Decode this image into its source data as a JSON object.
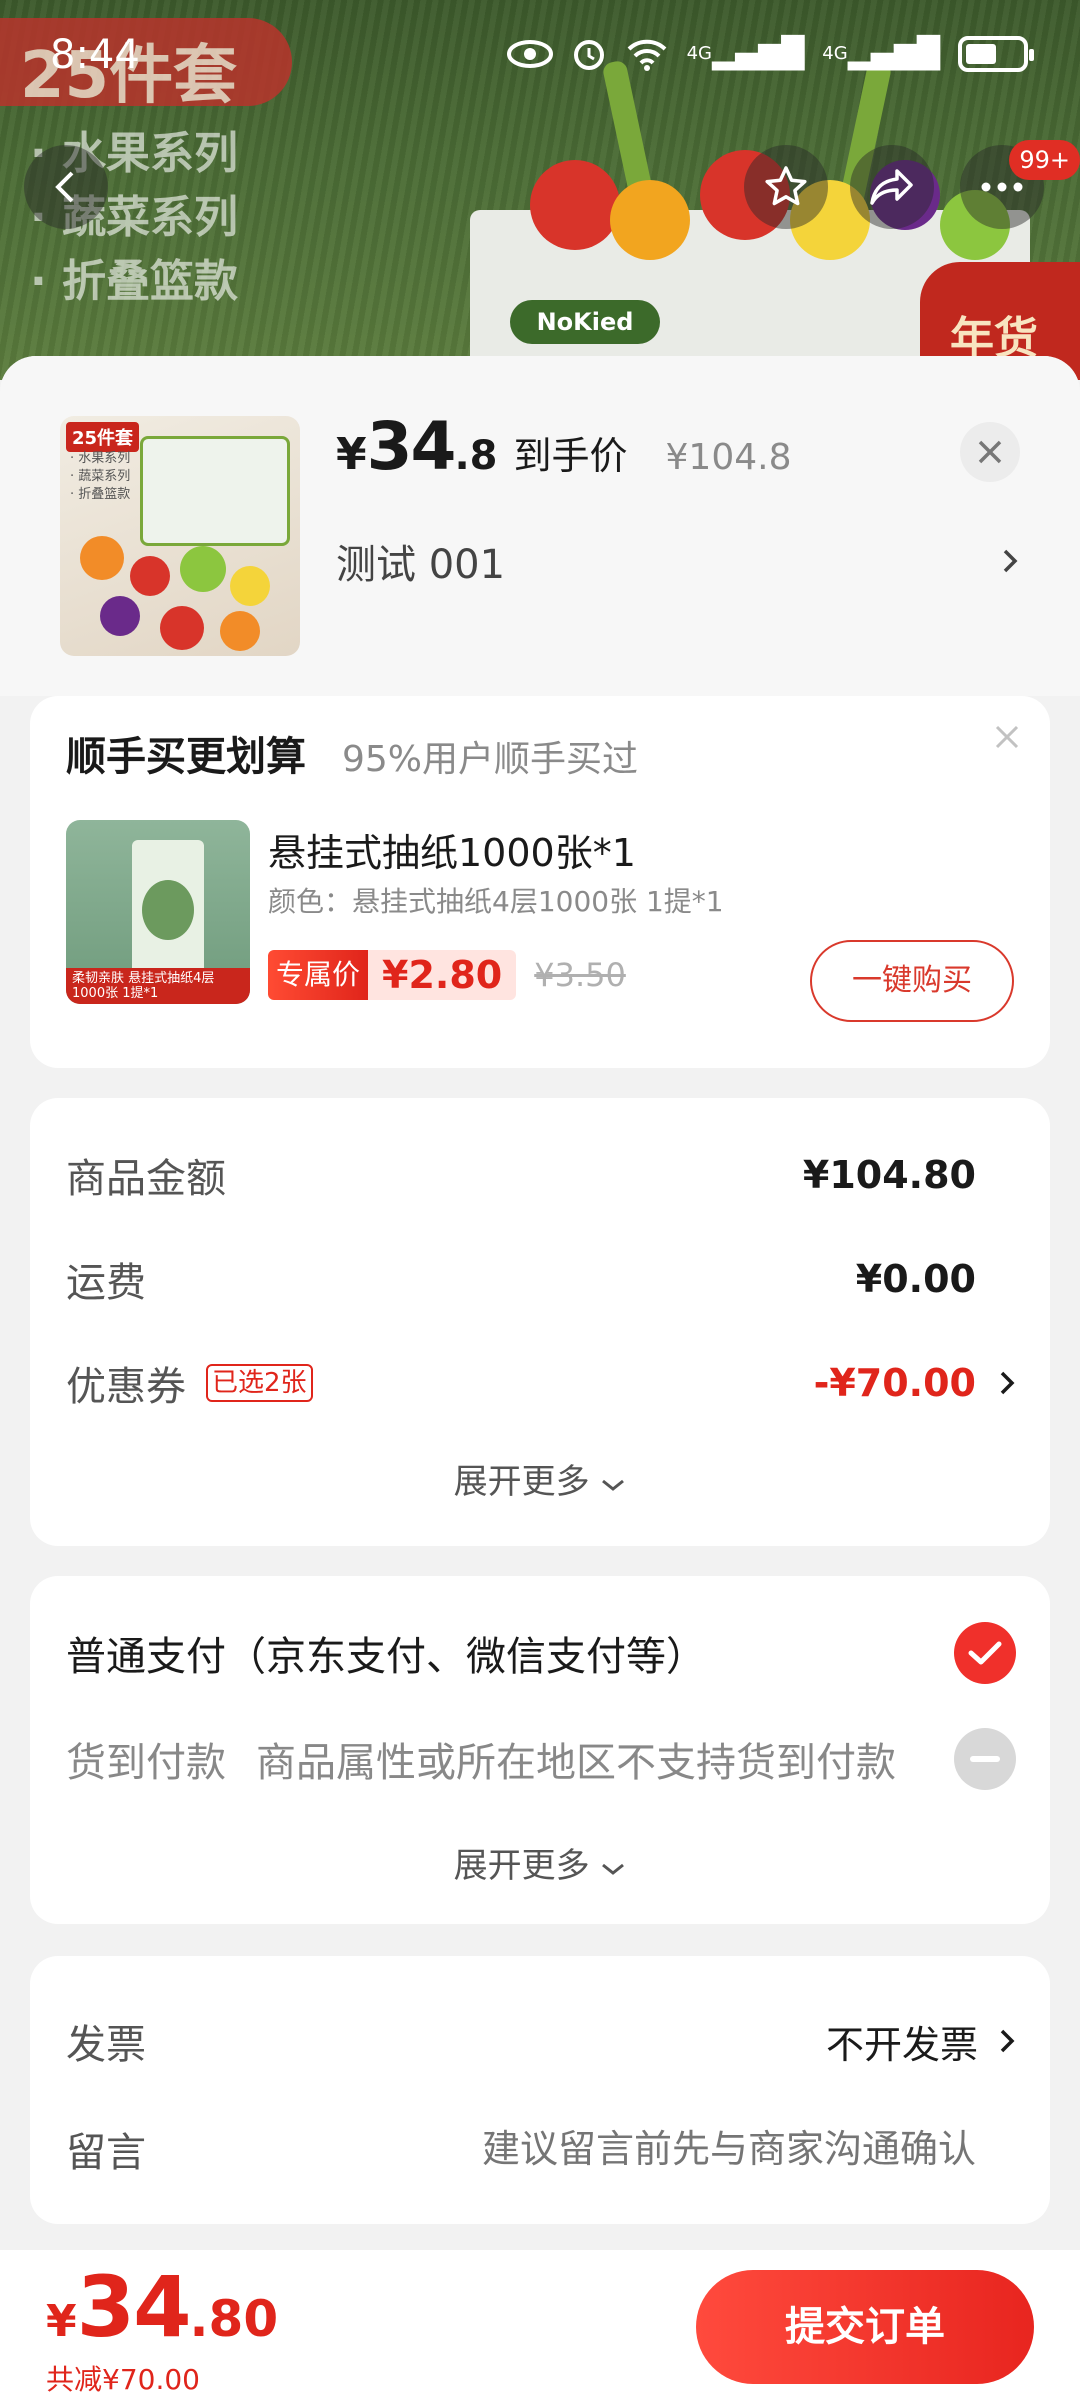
{
  "status_bar": {
    "time": "8:44",
    "net1": "4G",
    "net2": "4G"
  },
  "backdrop": {
    "badge_text": "25件套",
    "lines": [
      "· 水果系列",
      "· 蔬菜系列",
      "· 折叠篮款"
    ],
    "basket_logo": "NoKied",
    "promo_text": "年货节",
    "nav_badge": "99+"
  },
  "product": {
    "price_yen": "¥",
    "price_int": "34",
    "price_dec": ".8",
    "price_label": "到手价",
    "original_price": "¥104.8",
    "spec": "测试  001",
    "thumb_tag": "25件套",
    "thumb_lines": [
      "· 水果系列",
      "· 蔬菜系列",
      "· 折叠篮款"
    ]
  },
  "addon": {
    "title": "顺手买更划算",
    "subtitle": "95%用户顺手买过",
    "item_name": "悬挂式抽纸1000张*1",
    "item_spec": "颜色：悬挂式抽纸4层1000张 1提*1",
    "image_label": "柔韧亲肤 悬挂式抽纸4层1000张 1提*1",
    "exclusive_tag": "专属价",
    "exclusive_price": "¥2.80",
    "original_price": "¥3.50",
    "buy_label": "一键购买"
  },
  "amounts": {
    "goods_label": "商品金额",
    "goods_value": "¥104.80",
    "shipping_label": "运费",
    "shipping_value": "¥0.00",
    "coupon_label": "优惠券",
    "coupon_tag": "已选2张",
    "coupon_value": "-¥70.00",
    "expand_label": "展开更多"
  },
  "payment": {
    "normal_label": "普通支付（京东支付、微信支付等）",
    "cod_label": "货到付款",
    "cod_note": "商品属性或所在地区不支持货到付款",
    "expand_label": "展开更多"
  },
  "extras": {
    "invoice_label": "发票",
    "invoice_value": "不开发票",
    "message_label": "留言",
    "message_placeholder": "建议留言前先与商家沟通确认"
  },
  "bottom": {
    "total_yen": "¥",
    "total_int": "34",
    "total_dec": ".80",
    "saved": "共减¥70.00",
    "submit_label": "提交订单"
  },
  "colors": {
    "accent": "#e0251b",
    "button": "#f0302b"
  }
}
